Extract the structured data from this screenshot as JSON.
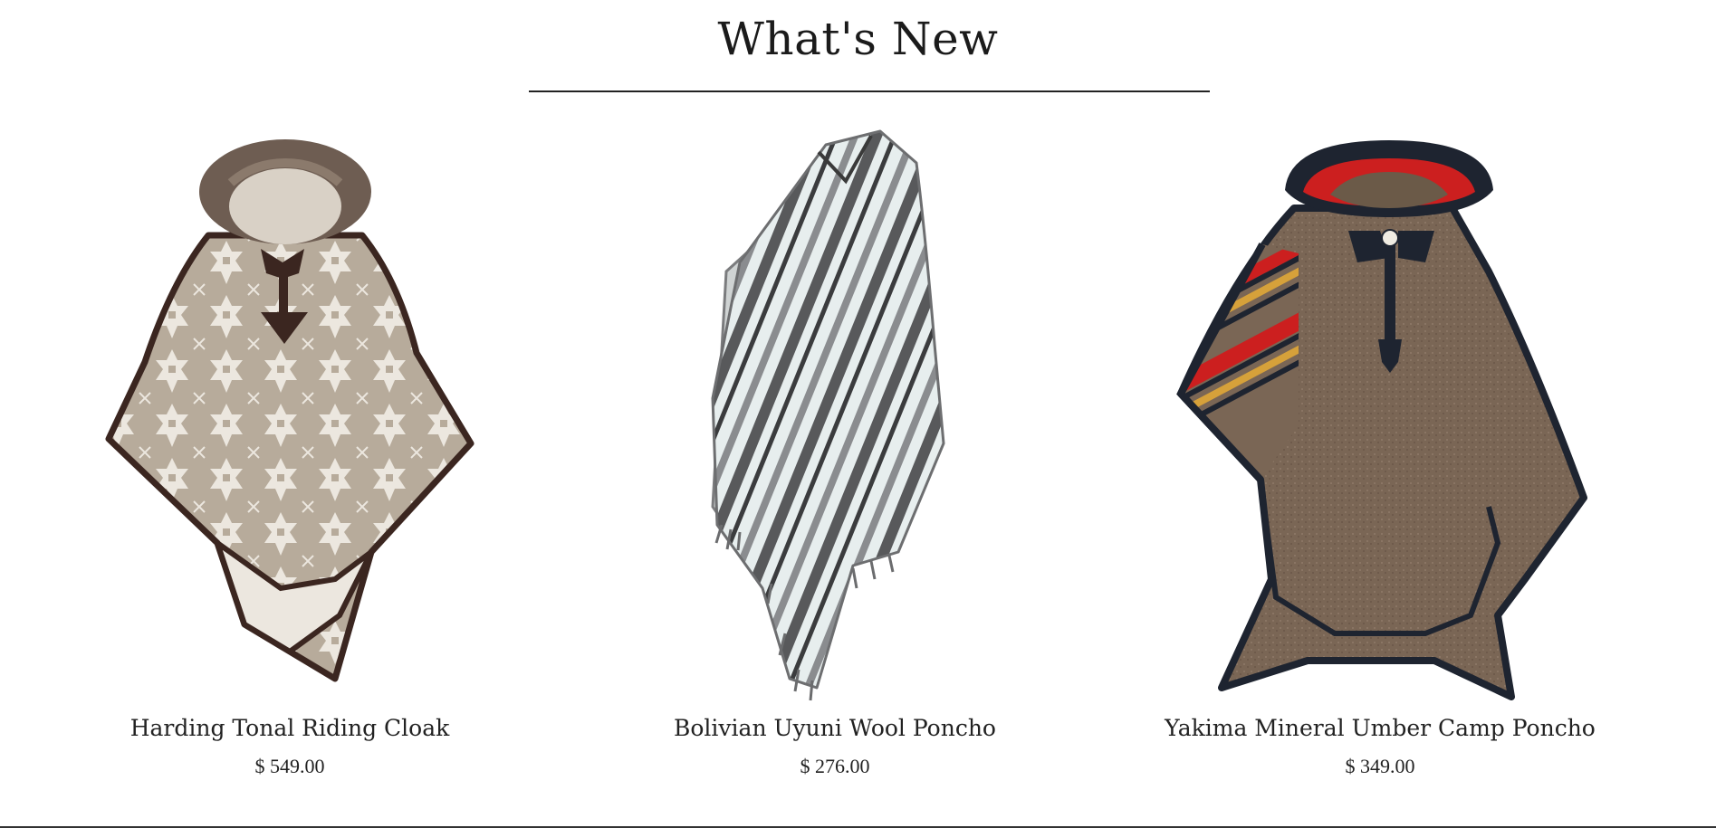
{
  "section": {
    "title": "What's New"
  },
  "products": [
    {
      "name": "Harding Tonal Riding Cloak",
      "price": "$ 549.00",
      "image_icon": "riding-cloak-image"
    },
    {
      "name": "Bolivian Uyuni Wool Poncho",
      "price": "$ 276.00",
      "image_icon": "wool-poncho-image"
    },
    {
      "name": "Yakima Mineral Umber Camp Poncho",
      "price": "$ 349.00",
      "image_icon": "camp-poncho-image"
    }
  ],
  "colors": {
    "cloak_base": "#b7ab9b",
    "cloak_light": "#ece7df",
    "cloak_trim": "#3b2620",
    "fur": "#6e5d52",
    "poncho_white": "#e7eeee",
    "poncho_gray": "#58595b",
    "umber": "#7a6655",
    "camp_trim": "#1e2430",
    "stripe_red": "#cc1f1f",
    "stripe_gold": "#d6a13a"
  }
}
